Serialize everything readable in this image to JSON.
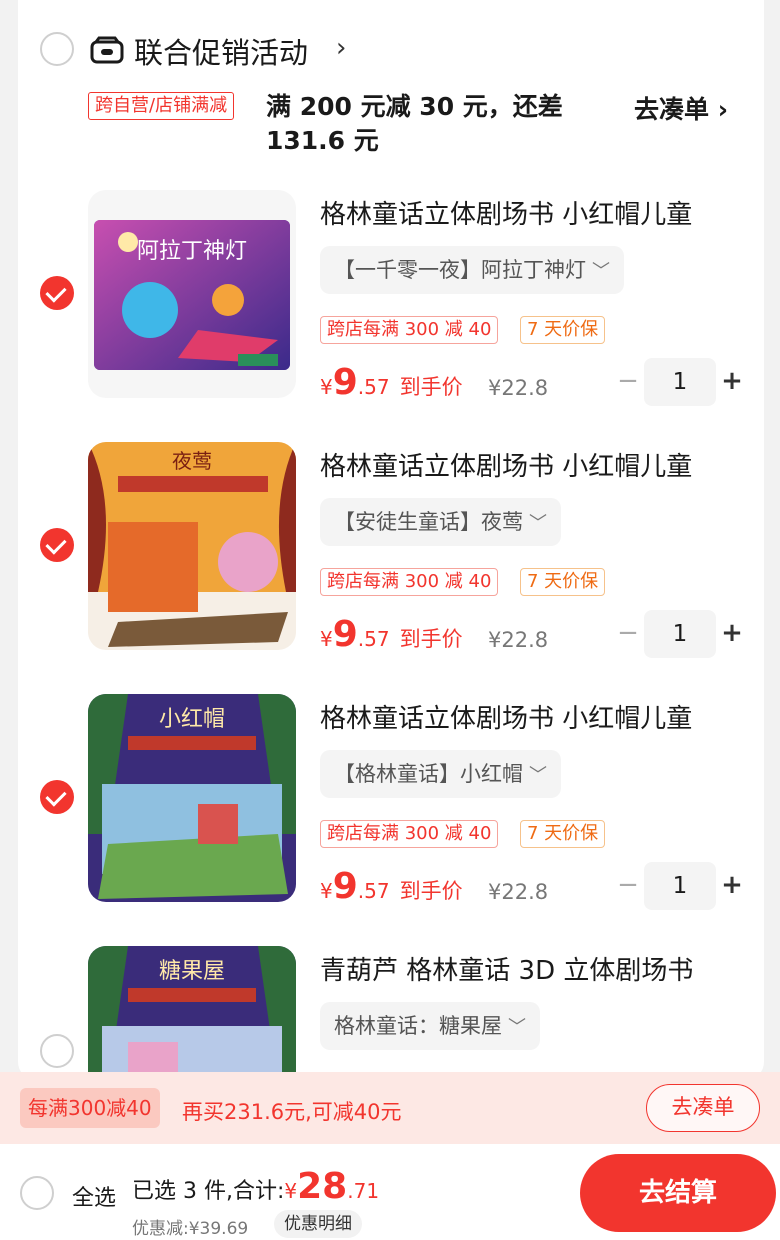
{
  "group": {
    "title": "联合促销活动",
    "chevron": "›",
    "icon": "shop-icon",
    "promo_tag": "跨自营/店铺满减",
    "promo_text": "满 200 元减 30 元，还差 131.6 元",
    "go_collect": "去凑单 ›"
  },
  "items": [
    {
      "checked": true,
      "title": "格林童话立体剧场书 小红帽儿童",
      "sku": "【一千零一夜】阿拉丁神灯",
      "tag1": "跨店每满 300 减 40",
      "tag2": "7 天价保",
      "price_yen": "¥",
      "price_int": "9",
      "price_dec": ".57",
      "price_label": "到手价",
      "orig_price": "¥22.8",
      "qty": "1",
      "cover_text": "阿拉丁神灯"
    },
    {
      "checked": true,
      "title": "格林童话立体剧场书 小红帽儿童",
      "sku": "【安徒生童话】夜莺",
      "tag1": "跨店每满 300 减 40",
      "tag2": "7 天价保",
      "price_yen": "¥",
      "price_int": "9",
      "price_dec": ".57",
      "price_label": "到手价",
      "orig_price": "¥22.8",
      "qty": "1",
      "cover_text": "夜莺"
    },
    {
      "checked": true,
      "title": "格林童话立体剧场书 小红帽儿童",
      "sku": "【格林童话】小红帽",
      "tag1": "跨店每满 300 减 40",
      "tag2": "7 天价保",
      "price_yen": "¥",
      "price_int": "9",
      "price_dec": ".57",
      "price_label": "到手价",
      "orig_price": "¥22.8",
      "qty": "1",
      "cover_text": "小红帽"
    },
    {
      "checked": false,
      "title": "青葫芦 格林童话 3D 立体剧场书",
      "sku": "格林童话：糖果屋",
      "cover_text": "糖果屋"
    }
  ],
  "promo_bar": {
    "tag": "每满300减40",
    "text": "再买231.6元,可减40元",
    "button": "去凑单"
  },
  "bottom": {
    "select_all": "全选",
    "summary_prefix": "已选 3 件,合计:",
    "total_yen": "¥",
    "total_int": "28",
    "total_dec": ".71",
    "discount": "优惠减:¥39.69",
    "detail_button": "优惠明细",
    "checkout_button": "去结算"
  },
  "colors": {
    "accent": "#f2352e",
    "orange": "#ef6b14"
  }
}
